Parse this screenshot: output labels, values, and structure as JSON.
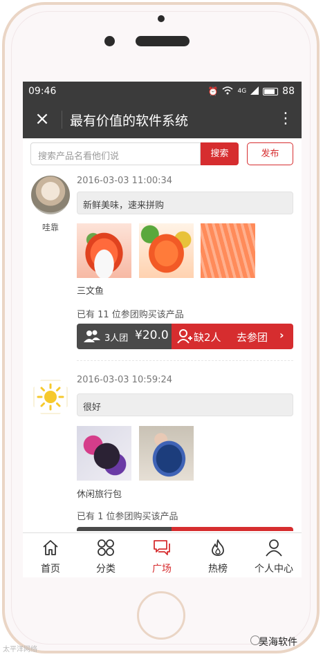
{
  "statusbar": {
    "time": "09:46",
    "battery_level": "88",
    "net_label": "4G"
  },
  "appbar": {
    "title": "最有价值的软件系统",
    "close_icon": "×",
    "more_icon": "⋮"
  },
  "search": {
    "placeholder": "搜索产品名看他们说",
    "search_label": "搜索",
    "publish_label": "发布"
  },
  "posts": [
    {
      "author": "哇靠",
      "time": "2016-03-03 11:00:34",
      "message": "新鲜美味，速来拼购",
      "product": "三文鱼",
      "group_count_text": "已有 11 位参团购买该产品",
      "team_size": "3人团",
      "price": "¥20.0",
      "missing": "缺2人",
      "join_label": "去参团",
      "chevron": "›"
    },
    {
      "author": "",
      "time": "2016-03-03 10:59:24",
      "message": "很好",
      "product": "休闲旅行包",
      "group_count_text": "已有 1 位参团购买该产品"
    }
  ],
  "tabs": [
    {
      "label": "首页",
      "icon": "home-icon",
      "active": false
    },
    {
      "label": "分类",
      "icon": "grid-icon",
      "active": false
    },
    {
      "label": "广场",
      "icon": "chat-icon",
      "active": true
    },
    {
      "label": "热榜",
      "icon": "flame-icon",
      "active": false
    },
    {
      "label": "个人中心",
      "icon": "user-icon",
      "active": false
    }
  ],
  "watermark": {
    "left": "太平洋网络",
    "right": "昊海软件"
  },
  "colors": {
    "accent": "#d62d2f",
    "bar_dark": "#3b3b3b",
    "action_dark": "#4a4a4a"
  }
}
